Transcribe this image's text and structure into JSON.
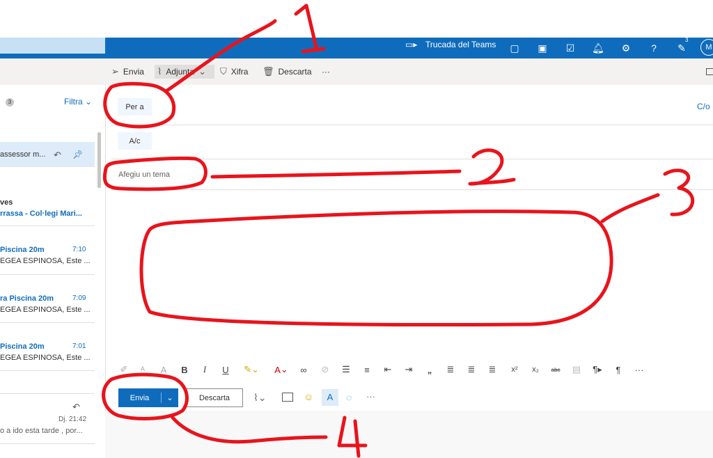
{
  "topbar": {
    "teams_label": "Trucada del Teams",
    "badge_count": "3",
    "avatar_initial": "M",
    "help_icon": "?",
    "icons": [
      "video-icon",
      "chat-icon",
      "office-icon",
      "todo-icon",
      "bell-icon",
      "gear-icon",
      "help-icon",
      "feedback-icon"
    ]
  },
  "toolbar": {
    "send": "Envia",
    "attach": "Adjunta",
    "encrypt": "Xifra",
    "discard": "Descarta",
    "more": "···"
  },
  "left": {
    "count": "3",
    "filter": "Filtra",
    "mails": [
      {
        "line1": "assessor m...",
        "line2": ""
      },
      {
        "line1": "ves",
        "line2": "rrassa - Col·legi Mari..."
      },
      {
        "line1": "Piscina 20m",
        "time": "7:10",
        "line2": "EGEA ESPINOSA, Este ..."
      },
      {
        "line1": "ra Piscina 20m",
        "time": "7:09",
        "line2": "EGEA ESPINOSA, Este ..."
      },
      {
        "line1": "Piscina 20m",
        "time": "7:01",
        "line2": "EGEA ESPINOSA, Este ..."
      },
      {
        "line1": "",
        "time": "Dj. 21:42",
        "line2": "o a ido esta tarde , por..."
      }
    ]
  },
  "compose": {
    "to_label": "Per a",
    "cc_link": "C/o",
    "bcc_label": "A/c",
    "subject_placeholder": "Afegiu un tema",
    "send_label": "Envia",
    "discard_label": "Descarta",
    "more": "···"
  },
  "format_toolbar": [
    "B",
    "I",
    "U",
    "A",
    "x²",
    "x₂",
    "abc",
    "¶",
    "„",
    "···"
  ],
  "annotations": {
    "n1": "1",
    "n2": "2",
    "n3": "3",
    "n4": "4",
    "color": "#e8141c"
  }
}
